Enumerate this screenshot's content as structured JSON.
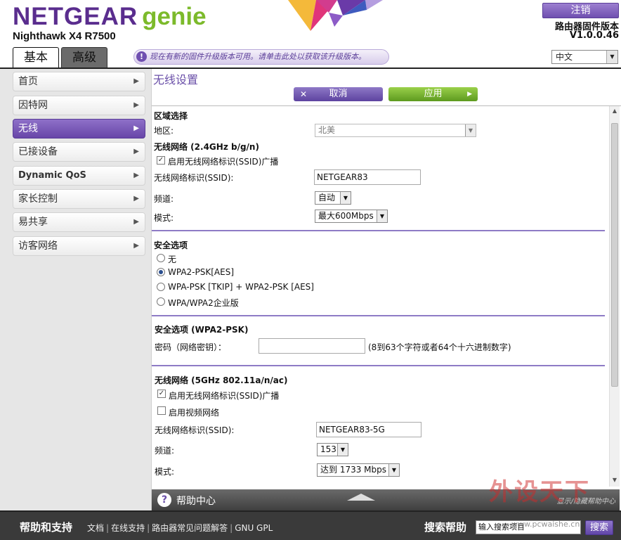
{
  "header": {
    "brand": "NETGEAR",
    "brand_product": "genie",
    "model": "Nighthawk X4 R7500",
    "logout": "注销",
    "firmware_label": "路由器固件版本",
    "firmware_version": "V1.0.0.46",
    "tabs": [
      {
        "label": "基本",
        "active": true
      },
      {
        "label": "高级",
        "active": false
      }
    ],
    "notice": "现在有新的固件升级版本可用。请单击此处以获取该升级版本。",
    "language": "中文",
    "colors": {
      "brand_purple": "#5a2d8e",
      "brand_green": "#7cba2b"
    }
  },
  "sidebar": {
    "items": [
      {
        "label": "首页"
      },
      {
        "label": "因特网"
      },
      {
        "label": "无线",
        "active": true
      },
      {
        "label": "已接设备"
      },
      {
        "label": "Dynamic QoS"
      },
      {
        "label": "家长控制"
      },
      {
        "label": "易共享"
      },
      {
        "label": "访客网络"
      }
    ]
  },
  "main": {
    "title": "无线设置",
    "cancel_label": "取消",
    "apply_label": "应用",
    "region_section": {
      "heading": "区域选择",
      "region_label": "地区:",
      "region_value": "北美"
    },
    "band24": {
      "heading": "无线网络 (2.4GHz b/g/n)",
      "broadcast_label": "启用无线网络标识(SSID)广播",
      "broadcast_checked": true,
      "ssid_label": "无线网络标识(SSID):",
      "ssid_value": "NETGEAR83",
      "channel_label": "频道:",
      "channel_value": "自动",
      "mode_label": "模式:",
      "mode_value": "最大600Mbps"
    },
    "security_options": {
      "heading": "安全选项",
      "options": [
        {
          "label": "无",
          "selected": false
        },
        {
          "label": "WPA2-PSK[AES]",
          "selected": true
        },
        {
          "label": "WPA-PSK [TKIP] + WPA2-PSK [AES]",
          "selected": false
        },
        {
          "label": "WPA/WPA2企业版",
          "selected": false
        }
      ]
    },
    "security_psk": {
      "heading": "安全选项 (WPA2-PSK)",
      "password_label": "密码（网络密钥）：",
      "password_value": "",
      "password_hint": "(8到63个字符或者64个十六进制数字)"
    },
    "band5": {
      "heading": "无线网络 (5GHz 802.11a/n/ac)",
      "broadcast_label": "启用无线网络标识(SSID)广播",
      "broadcast_checked": true,
      "video_label": "启用视频网络",
      "video_checked": false,
      "ssid_label": "无线网络标识(SSID):",
      "ssid_value": "NETGEAR83-5G",
      "channel_label": "频道:",
      "channel_value": "153",
      "mode_label": "模式:",
      "mode_value": "达到 1733 Mbps"
    }
  },
  "help_bar": {
    "label": "帮助中心",
    "link": "显示/隐藏帮助中心"
  },
  "footer": {
    "title": "帮助和支持",
    "links": [
      "文档",
      "在线支持",
      "路由器常见问题解答",
      "GNU GPL"
    ],
    "search_label": "搜索帮助",
    "search_placeholder": "输入搜索项目",
    "search_button": "搜索"
  },
  "watermark": {
    "text": "外设天下",
    "url": "www.pcwaishe.cn"
  }
}
